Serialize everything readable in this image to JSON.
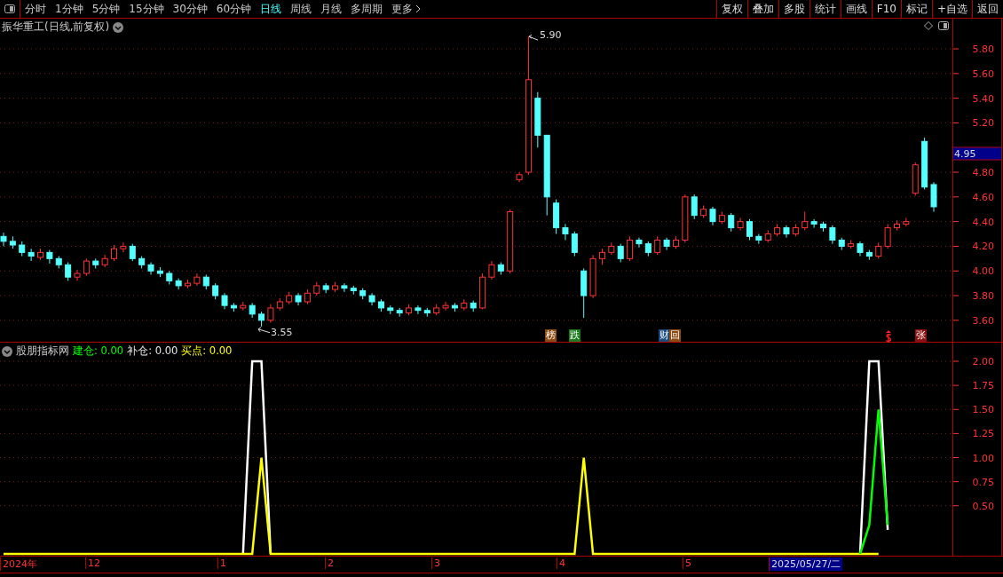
{
  "toolbar": {
    "periods": [
      {
        "label": "分时",
        "selected": false
      },
      {
        "label": "1分钟",
        "selected": false
      },
      {
        "label": "5分钟",
        "selected": false
      },
      {
        "label": "15分钟",
        "selected": false
      },
      {
        "label": "30分钟",
        "selected": false
      },
      {
        "label": "60分钟",
        "selected": false
      },
      {
        "label": "日线",
        "selected": true
      },
      {
        "label": "周线",
        "selected": false
      },
      {
        "label": "月线",
        "selected": false
      },
      {
        "label": "多周期",
        "selected": false
      },
      {
        "label": "更多",
        "selected": false
      }
    ],
    "actions": [
      "复权",
      "叠加",
      "多股",
      "统计",
      "画线",
      "F10",
      "标记",
      "+自选",
      "返回"
    ]
  },
  "main_chart": {
    "title": "振华重工(日线,前复权)",
    "chart_data": {
      "type": "candlestick",
      "ylim": [
        3.426,
        6.045
      ],
      "grid": true,
      "yticks": [
        {
          "value": 5.8,
          "label": "5.80"
        },
        {
          "value": 5.6,
          "label": "5.60"
        },
        {
          "value": 5.4,
          "label": "5.40"
        },
        {
          "value": 5.2,
          "label": "5.20"
        },
        {
          "value": 4.8,
          "label": "4.80"
        },
        {
          "value": 4.6,
          "label": "4.60"
        },
        {
          "value": 4.4,
          "label": "4.40"
        },
        {
          "value": 4.2,
          "label": "4.20"
        },
        {
          "value": 4.0,
          "label": "4.00"
        },
        {
          "value": 3.8,
          "label": "3.80"
        },
        {
          "value": 3.6,
          "label": "3.60"
        }
      ],
      "ohlc": [
        [
          4.28,
          4.31,
          4.2,
          4.24
        ],
        [
          4.24,
          4.28,
          4.18,
          4.21
        ],
        [
          4.21,
          4.24,
          4.12,
          4.15
        ],
        [
          4.15,
          4.18,
          4.08,
          4.12
        ],
        [
          4.11,
          4.18,
          4.09,
          4.15
        ],
        [
          4.15,
          4.17,
          4.06,
          4.1
        ],
        [
          4.1,
          4.12,
          4.02,
          4.05
        ],
        [
          4.05,
          4.07,
          3.92,
          3.95
        ],
        [
          3.95,
          4.01,
          3.92,
          3.98
        ],
        [
          3.98,
          4.1,
          3.96,
          4.08
        ],
        [
          4.08,
          4.1,
          4.02,
          4.05
        ],
        [
          4.05,
          4.13,
          4.03,
          4.1
        ],
        [
          4.1,
          4.21,
          4.08,
          4.18
        ],
        [
          4.18,
          4.23,
          4.15,
          4.2
        ],
        [
          4.2,
          4.22,
          4.08,
          4.1
        ],
        [
          4.1,
          4.12,
          4.02,
          4.05
        ],
        [
          4.05,
          4.07,
          3.97,
          4.0
        ],
        [
          4.0,
          4.03,
          3.95,
          3.98
        ],
        [
          3.98,
          4.0,
          3.89,
          3.92
        ],
        [
          3.92,
          3.94,
          3.85,
          3.88
        ],
        [
          3.88,
          3.93,
          3.86,
          3.9
        ],
        [
          3.9,
          3.98,
          3.88,
          3.95
        ],
        [
          3.95,
          3.97,
          3.85,
          3.88
        ],
        [
          3.88,
          3.9,
          3.77,
          3.8
        ],
        [
          3.8,
          3.82,
          3.69,
          3.72
        ],
        [
          3.72,
          3.74,
          3.67,
          3.7
        ],
        [
          3.7,
          3.75,
          3.68,
          3.72
        ],
        [
          3.72,
          3.74,
          3.62,
          3.65
        ],
        [
          3.65,
          3.67,
          3.55,
          3.6
        ],
        [
          3.6,
          3.73,
          3.58,
          3.7
        ],
        [
          3.7,
          3.78,
          3.68,
          3.75
        ],
        [
          3.75,
          3.83,
          3.73,
          3.8
        ],
        [
          3.8,
          3.82,
          3.72,
          3.75
        ],
        [
          3.75,
          3.85,
          3.73,
          3.82
        ],
        [
          3.82,
          3.91,
          3.8,
          3.88
        ],
        [
          3.88,
          3.9,
          3.82,
          3.85
        ],
        [
          3.85,
          3.91,
          3.83,
          3.88
        ],
        [
          3.88,
          3.9,
          3.83,
          3.86
        ],
        [
          3.86,
          3.88,
          3.81,
          3.84
        ],
        [
          3.84,
          3.86,
          3.77,
          3.8
        ],
        [
          3.8,
          3.82,
          3.72,
          3.75
        ],
        [
          3.75,
          3.77,
          3.67,
          3.7
        ],
        [
          3.7,
          3.72,
          3.65,
          3.68
        ],
        [
          3.68,
          3.7,
          3.63,
          3.66
        ],
        [
          3.66,
          3.73,
          3.64,
          3.7
        ],
        [
          3.7,
          3.72,
          3.65,
          3.68
        ],
        [
          3.68,
          3.7,
          3.63,
          3.66
        ],
        [
          3.66,
          3.73,
          3.64,
          3.7
        ],
        [
          3.7,
          3.75,
          3.68,
          3.72
        ],
        [
          3.72,
          3.74,
          3.67,
          3.7
        ],
        [
          3.7,
          3.77,
          3.68,
          3.74
        ],
        [
          3.74,
          3.76,
          3.67,
          3.7
        ],
        [
          3.7,
          3.98,
          3.69,
          3.95
        ],
        [
          3.95,
          4.08,
          3.93,
          4.05
        ],
        [
          4.05,
          4.07,
          3.97,
          4.0
        ],
        [
          4.0,
          4.5,
          3.98,
          4.48
        ],
        [
          4.74,
          4.8,
          4.72,
          4.78
        ],
        [
          4.8,
          5.9,
          4.78,
          5.55
        ],
        [
          5.4,
          5.45,
          5.0,
          5.1
        ],
        [
          5.1,
          5.1,
          4.45,
          4.6
        ],
        [
          4.55,
          4.58,
          4.3,
          4.35
        ],
        [
          4.35,
          4.38,
          4.25,
          4.3
        ],
        [
          4.3,
          4.32,
          4.12,
          4.15
        ],
        [
          4.0,
          4.02,
          3.62,
          3.8
        ],
        [
          3.8,
          4.13,
          3.78,
          4.1
        ],
        [
          4.1,
          4.18,
          4.05,
          4.15
        ],
        [
          4.15,
          4.23,
          4.13,
          4.2
        ],
        [
          4.2,
          4.22,
          4.07,
          4.1
        ],
        [
          4.1,
          4.28,
          4.08,
          4.25
        ],
        [
          4.25,
          4.27,
          4.19,
          4.22
        ],
        [
          4.22,
          4.24,
          4.12,
          4.15
        ],
        [
          4.15,
          4.28,
          4.13,
          4.25
        ],
        [
          4.25,
          4.27,
          4.17,
          4.2
        ],
        [
          4.2,
          4.28,
          4.18,
          4.25
        ],
        [
          4.25,
          4.62,
          4.23,
          4.6
        ],
        [
          4.6,
          4.62,
          4.42,
          4.45
        ],
        [
          4.45,
          4.53,
          4.43,
          4.5
        ],
        [
          4.5,
          4.52,
          4.37,
          4.4
        ],
        [
          4.4,
          4.48,
          4.38,
          4.45
        ],
        [
          4.45,
          4.47,
          4.32,
          4.35
        ],
        [
          4.35,
          4.43,
          4.33,
          4.4
        ],
        [
          4.4,
          4.42,
          4.25,
          4.28
        ],
        [
          4.28,
          4.3,
          4.22,
          4.25
        ],
        [
          4.25,
          4.33,
          4.23,
          4.3
        ],
        [
          4.3,
          4.38,
          4.28,
          4.35
        ],
        [
          4.35,
          4.37,
          4.27,
          4.3
        ],
        [
          4.3,
          4.38,
          4.28,
          4.35
        ],
        [
          4.35,
          4.48,
          4.33,
          4.4
        ],
        [
          4.4,
          4.42,
          4.35,
          4.38
        ],
        [
          4.38,
          4.4,
          4.32,
          4.35
        ],
        [
          4.35,
          4.37,
          4.22,
          4.25
        ],
        [
          4.25,
          4.27,
          4.17,
          4.2
        ],
        [
          4.2,
          4.25,
          4.18,
          4.22
        ],
        [
          4.22,
          4.24,
          4.12,
          4.15
        ],
        [
          4.15,
          4.17,
          4.09,
          4.12
        ],
        [
          4.12,
          4.23,
          4.1,
          4.2
        ],
        [
          4.2,
          4.38,
          4.18,
          4.35
        ],
        [
          4.35,
          4.41,
          4.33,
          4.38
        ],
        [
          4.38,
          4.43,
          4.36,
          4.4
        ],
        [
          4.63,
          4.88,
          4.61,
          4.86
        ],
        [
          5.05,
          5.08,
          4.66,
          4.68
        ],
        [
          4.7,
          4.72,
          4.48,
          4.52
        ]
      ]
    },
    "high_label": "5.90",
    "low_label": "3.55",
    "current_price": "4.95",
    "events": [
      {
        "label": "榜",
        "color": "#8b4a10"
      },
      {
        "label": "跌",
        "color": "#1e7a1e"
      },
      {
        "label": "财",
        "color": "#1a4a80"
      },
      {
        "label": "回",
        "color": "#8b4a10"
      },
      {
        "label": "张",
        "color": "#8a1010"
      }
    ]
  },
  "indicator": {
    "title": "股朋指标网",
    "readings": [
      {
        "label": "建仓:",
        "value": "0.00",
        "color": "#00ff00"
      },
      {
        "label": "补仓:",
        "value": "0.00",
        "color": "#e8e8e8"
      },
      {
        "label": "买点:",
        "value": "0.00",
        "color": "#ffff00"
      }
    ],
    "chart_data": {
      "type": "line",
      "ylim": [
        0,
        2
      ],
      "grid": true,
      "yticks": [
        {
          "value": 2,
          "label": "2.00"
        },
        {
          "value": 1.75,
          "label": "1.75"
        },
        {
          "value": 1.5,
          "label": "1.50"
        },
        {
          "value": 1.25,
          "label": "1.25"
        },
        {
          "value": 1,
          "label": "1.00"
        },
        {
          "value": 0.75,
          "label": "0.75"
        },
        {
          "value": 0.5,
          "label": "0.50"
        }
      ],
      "series": [
        {
          "color": "#ffffff",
          "values": [
            null,
            null,
            null,
            null,
            null,
            null,
            null,
            null,
            null,
            null,
            null,
            null,
            null,
            null,
            null,
            null,
            null,
            null,
            null,
            null,
            null,
            null,
            null,
            null,
            null,
            null,
            0,
            2,
            2,
            0,
            null,
            null,
            null,
            null,
            null,
            null,
            null,
            null,
            null,
            null,
            null,
            null,
            null,
            null,
            null,
            null,
            null,
            null,
            null,
            null,
            null,
            null,
            null,
            null,
            null,
            null,
            null,
            null,
            null,
            null,
            null,
            null,
            null,
            null,
            null,
            null,
            null,
            null,
            null,
            null,
            null,
            null,
            null,
            null,
            null,
            null,
            null,
            null,
            null,
            null,
            null,
            null,
            null,
            null,
            null,
            null,
            null,
            null,
            null,
            null,
            null,
            null,
            null,
            0,
            2,
            2,
            0.25,
            null,
            null,
            null,
            null,
            null
          ]
        },
        {
          "color": "#ffff00",
          "values": [
            0,
            0,
            0,
            0,
            0,
            0,
            0,
            0,
            0,
            0,
            0,
            0,
            0,
            0,
            0,
            0,
            0,
            0,
            0,
            0,
            0,
            0,
            0,
            0,
            0,
            0,
            0,
            0,
            1,
            0,
            0,
            0,
            0,
            0,
            0,
            0,
            0,
            0,
            0,
            0,
            0,
            0,
            0,
            0,
            0,
            0,
            0,
            0,
            0,
            0,
            0,
            0,
            0,
            0,
            0,
            0,
            0,
            0,
            0,
            0,
            0,
            0,
            0,
            1,
            0,
            0,
            0,
            0,
            0,
            0,
            0,
            0,
            0,
            0,
            0,
            0,
            0,
            0,
            0,
            0,
            0,
            0,
            0,
            0,
            0,
            0,
            0,
            0,
            0,
            0,
            0,
            0,
            0,
            0,
            0,
            0,
            null,
            null,
            null,
            null,
            null,
            null
          ]
        },
        {
          "color": "#00ff00",
          "values": [
            null,
            null,
            null,
            null,
            null,
            null,
            null,
            null,
            null,
            null,
            null,
            null,
            null,
            null,
            null,
            null,
            null,
            null,
            null,
            null,
            null,
            null,
            null,
            null,
            null,
            null,
            null,
            null,
            null,
            null,
            null,
            null,
            null,
            null,
            null,
            null,
            null,
            null,
            null,
            null,
            null,
            null,
            null,
            null,
            null,
            null,
            null,
            null,
            null,
            null,
            null,
            null,
            null,
            null,
            null,
            null,
            null,
            null,
            null,
            null,
            null,
            null,
            null,
            null,
            null,
            null,
            null,
            null,
            null,
            null,
            null,
            null,
            null,
            null,
            null,
            null,
            null,
            null,
            null,
            null,
            null,
            null,
            null,
            null,
            null,
            null,
            null,
            null,
            null,
            null,
            null,
            null,
            null,
            0,
            0.3,
            1.5,
            0.3,
            null,
            null,
            null,
            null,
            null
          ]
        }
      ]
    }
  },
  "time_axis": [
    {
      "label": "2024年",
      "selected": false
    },
    {
      "label": "12",
      "selected": false
    },
    {
      "label": "1",
      "selected": false
    },
    {
      "label": "2",
      "selected": false
    },
    {
      "label": "3",
      "selected": false
    },
    {
      "label": "4",
      "selected": false
    },
    {
      "label": "5",
      "selected": false
    },
    {
      "label": "2025/05/27/二",
      "selected": true
    }
  ]
}
